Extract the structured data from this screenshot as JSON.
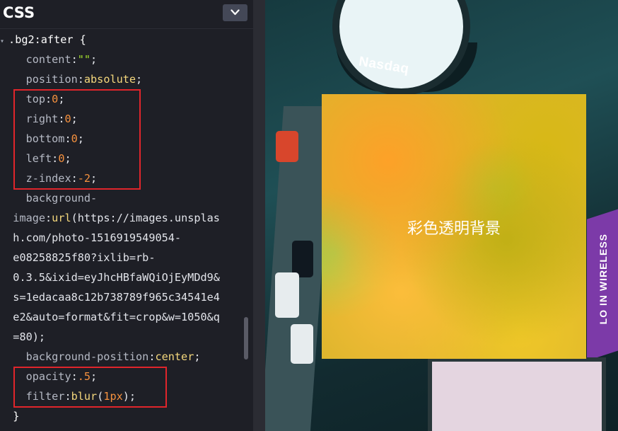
{
  "editor": {
    "title": "CSS",
    "collapse_icon": "chevron-down-icon",
    "lines": [
      {
        "arrow": "▾",
        "tokens": [
          {
            "t": ".bg2",
            "c": "sel"
          },
          {
            "t": ":after {",
            "c": "sel"
          }
        ]
      },
      {
        "tokens": [
          {
            "t": "  content",
            "c": "prop"
          },
          {
            "t": ":",
            "c": "punc"
          },
          {
            "t": "\"\"",
            "c": "str"
          },
          {
            "t": ";",
            "c": "punc"
          }
        ]
      },
      {
        "tokens": [
          {
            "t": "  position",
            "c": "prop"
          },
          {
            "t": ":",
            "c": "punc"
          },
          {
            "t": "absolute",
            "c": "kw"
          },
          {
            "t": ";",
            "c": "punc"
          }
        ]
      },
      {
        "tokens": [
          {
            "t": "  top",
            "c": "prop"
          },
          {
            "t": ":",
            "c": "punc"
          },
          {
            "t": "0",
            "c": "num"
          },
          {
            "t": ";",
            "c": "punc"
          }
        ]
      },
      {
        "tokens": [
          {
            "t": "  right",
            "c": "prop"
          },
          {
            "t": ":",
            "c": "punc"
          },
          {
            "t": "0",
            "c": "num"
          },
          {
            "t": ";",
            "c": "punc"
          }
        ]
      },
      {
        "tokens": [
          {
            "t": "  bottom",
            "c": "prop"
          },
          {
            "t": ":",
            "c": "punc"
          },
          {
            "t": "0",
            "c": "num"
          },
          {
            "t": ";",
            "c": "punc"
          }
        ]
      },
      {
        "tokens": [
          {
            "t": "  left",
            "c": "prop"
          },
          {
            "t": ":",
            "c": "punc"
          },
          {
            "t": "0",
            "c": "num"
          },
          {
            "t": ";",
            "c": "punc"
          }
        ]
      },
      {
        "tokens": [
          {
            "t": "  z-index",
            "c": "prop"
          },
          {
            "t": ":",
            "c": "punc"
          },
          {
            "t": "-2",
            "c": "num"
          },
          {
            "t": ";",
            "c": "punc"
          }
        ]
      },
      {
        "tokens": [
          {
            "t": "  background-",
            "c": "prop"
          }
        ]
      },
      {
        "tokens": [
          {
            "t": "image",
            "c": "prop"
          },
          {
            "t": ":",
            "c": "punc"
          },
          {
            "t": "url",
            "c": "kw"
          },
          {
            "t": "(",
            "c": "punc"
          },
          {
            "t": "https://images.unsplas",
            "c": "url"
          }
        ]
      },
      {
        "tokens": [
          {
            "t": "h.com/photo-1516919549054-",
            "c": "url"
          }
        ]
      },
      {
        "tokens": [
          {
            "t": "e08258825f80?ixlib=rb-",
            "c": "url"
          }
        ]
      },
      {
        "tokens": [
          {
            "t": "0.3.5&ixid=eyJhcHBfaWQiOjEyMDd9&",
            "c": "url"
          }
        ]
      },
      {
        "tokens": [
          {
            "t": "s=1edacaa8c12b738789f965c34541e4",
            "c": "url"
          }
        ]
      },
      {
        "tokens": [
          {
            "t": "e2&auto=format&fit=crop&w=1050&q",
            "c": "url"
          }
        ]
      },
      {
        "tokens": [
          {
            "t": "=80",
            "c": "url"
          },
          {
            "t": ");",
            "c": "punc"
          }
        ]
      },
      {
        "tokens": [
          {
            "t": "  background-position",
            "c": "prop"
          },
          {
            "t": ":",
            "c": "punc"
          },
          {
            "t": "center",
            "c": "kw"
          },
          {
            "t": ";",
            "c": "punc"
          }
        ]
      },
      {
        "tokens": [
          {
            "t": "  opacity",
            "c": "prop"
          },
          {
            "t": ":",
            "c": "punc"
          },
          {
            "t": ".5",
            "c": "num"
          },
          {
            "t": ";",
            "c": "punc"
          }
        ]
      },
      {
        "tokens": [
          {
            "t": "  filter",
            "c": "prop"
          },
          {
            "t": ":",
            "c": "punc"
          },
          {
            "t": "blur",
            "c": "kw"
          },
          {
            "t": "(",
            "c": "punc"
          },
          {
            "t": "1px",
            "c": "num"
          },
          {
            "t": ");",
            "c": "punc"
          }
        ]
      },
      {
        "tokens": [
          {
            "t": "}",
            "c": "sel"
          }
        ]
      }
    ]
  },
  "preview": {
    "box_label": "彩色透明背景",
    "sign_text": "Nasdaq",
    "billboard_text": "LO IN WIRELESS"
  },
  "colors": {
    "highlight": "#e0252b",
    "keyword": "#f4d77c",
    "number": "#f6913e",
    "string": "#a6e22e"
  }
}
